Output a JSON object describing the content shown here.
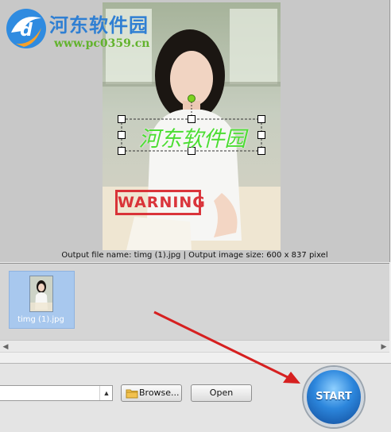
{
  "watermark": {
    "site_name": "河东软件园",
    "site_url": "www.pc0359.cn"
  },
  "preview": {
    "text_watermark": "河东软件园",
    "stamp_text": "WARNING",
    "status": "Output file name: timg (1).jpg | Output image size: 600 x 837 pixel"
  },
  "thumbnails": {
    "items": [
      {
        "label": "timg (1).jpg"
      }
    ]
  },
  "toolbar": {
    "output_select_value": "",
    "browse_label": "Browse...",
    "open_label": "Open",
    "start_label": "START"
  },
  "icons": {
    "folder": "folder-icon",
    "scroll_left": "chevron-left-icon",
    "scroll_right": "chevron-right-icon",
    "select_arrow": "spinner-arrows-icon"
  },
  "colors": {
    "watermark_text": "#4cdd33",
    "stamp": "#d8242c",
    "start_button": "#2c86dc",
    "selection": "#a8c8ee"
  }
}
